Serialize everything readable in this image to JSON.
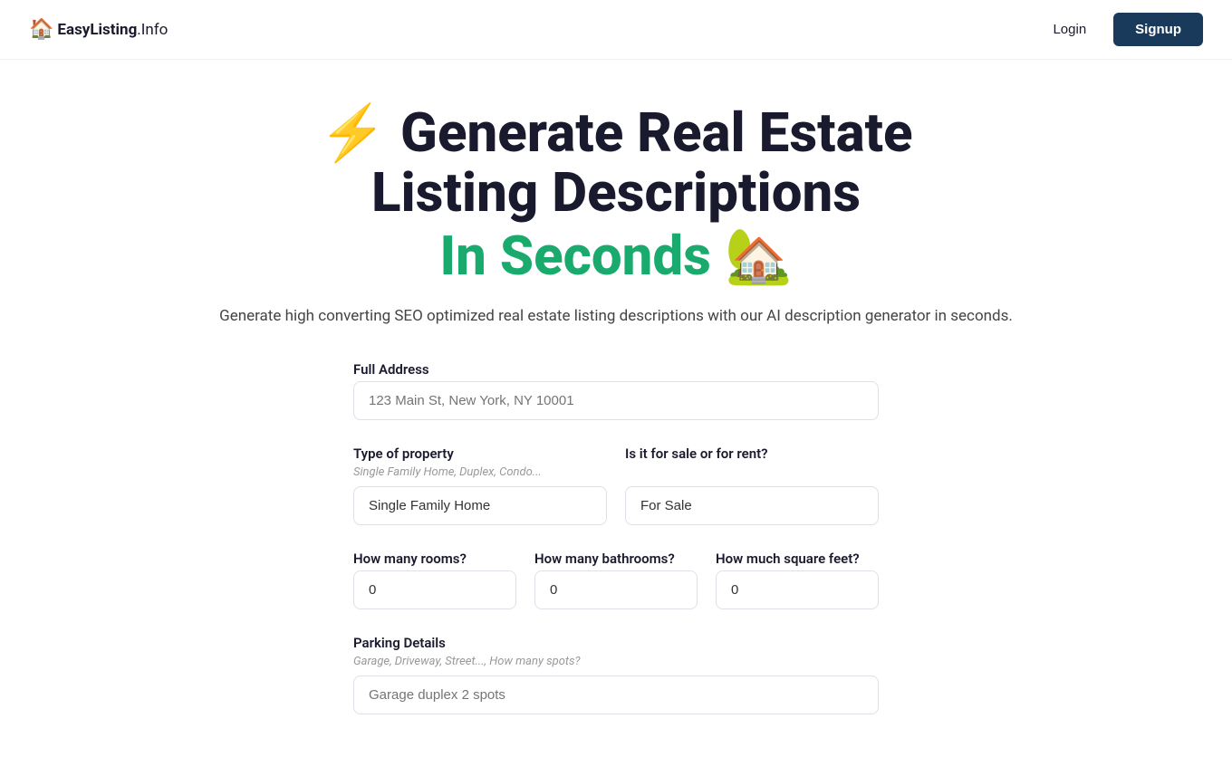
{
  "nav": {
    "logo_emoji": "🏠",
    "logo_name": "EasyListing",
    "logo_info": ".Info",
    "login_label": "Login",
    "signup_label": "Signup"
  },
  "hero": {
    "line1_emoji": "⚡",
    "line1_text": "Generate Real Estate",
    "line2_text": "Listing Descriptions",
    "line3_text": "In Seconds",
    "line3_emoji": "🏡",
    "description": "Generate high converting SEO optimized real estate listing descriptions with our AI description generator in seconds."
  },
  "form": {
    "address": {
      "label": "Full Address",
      "placeholder": "123 Main St, New York, NY 10001",
      "value": ""
    },
    "property_type": {
      "label": "Type of property",
      "hint": "Single Family Home, Duplex, Condo...",
      "value": "Single Family Home"
    },
    "sale_rent": {
      "label": "Is it for sale or for rent?",
      "hint": "",
      "value": "For Sale"
    },
    "rooms": {
      "label": "How many rooms?",
      "value": "0"
    },
    "bathrooms": {
      "label": "How many bathrooms?",
      "value": "0"
    },
    "sqft": {
      "label": "How much square feet?",
      "value": "0"
    },
    "parking": {
      "label": "Parking Details",
      "hint": "Garage, Driveway, Street..., How many spots?",
      "placeholder": "Garage duplex 2 spots",
      "value": ""
    }
  }
}
